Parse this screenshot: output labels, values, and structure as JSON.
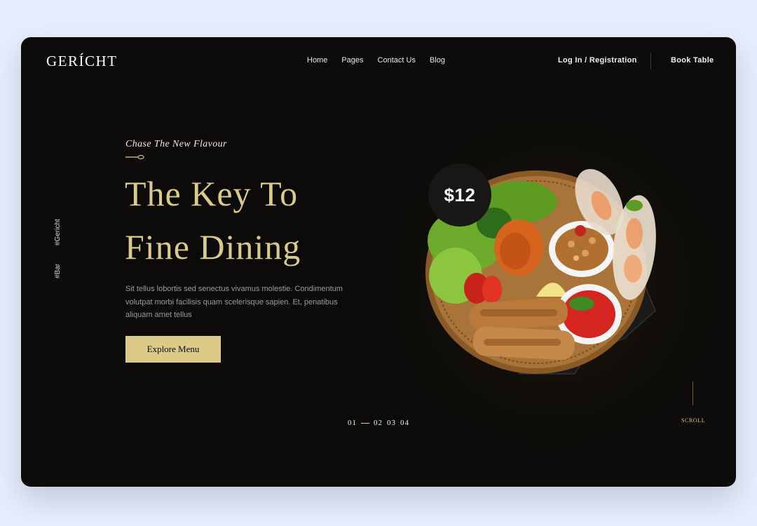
{
  "brand": {
    "logo": "GERÍCHT"
  },
  "nav": {
    "home": "Home",
    "pages": "Pages",
    "contact": "Contact Us",
    "blog": "Blog"
  },
  "header": {
    "login": "Log In / Registration",
    "book": "Book Table"
  },
  "side_tags": {
    "gericht": "#Gericht",
    "bar": "#Bar"
  },
  "hero": {
    "tagline": "Chase The New Flavour",
    "title_line1": "The Key To",
    "title_line2": "Fine Dining",
    "description": "Sit tellus lobortis sed senectus vivamus molestie. Condimentum volutpat morbi facilisis quam scelerisque sapien. Et, penatibus aliquam amet tellus",
    "cta": "Explore Menu"
  },
  "pager": {
    "p1": "01",
    "p2": "02",
    "p3": "03",
    "p4": "04",
    "active": 1
  },
  "scroll": {
    "label": "SCROLL"
  },
  "price": {
    "label": "$12"
  },
  "colors": {
    "accent": "#dcca87",
    "background": "#0c0b09",
    "page": "#e6edfc"
  },
  "icons": {
    "spoon": "spoon-icon",
    "dish": "food-platter-image"
  }
}
